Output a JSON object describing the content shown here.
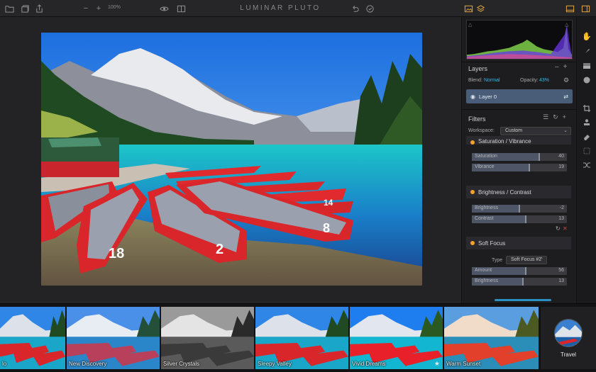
{
  "toolbar": {
    "zoom": "100%",
    "app_title": "LUMINAR PLUTO"
  },
  "layers": {
    "title": "Layers",
    "blend_label": "Blend:",
    "blend_value": "Normal",
    "opacity_label": "Opacity:",
    "opacity_value": "43%",
    "layer_name": "Layer 0"
  },
  "filters": {
    "title": "Filters",
    "workspace_label": "Workspace:",
    "workspace_value": "Custom",
    "groups": [
      {
        "title": "Saturation / Vibrance",
        "sliders": [
          {
            "label": "Saturation",
            "value": "40",
            "level": 0.7
          },
          {
            "label": "Vibrance",
            "value": "19",
            "level": 0.6
          }
        ]
      },
      {
        "title": "Brightness / Contrast",
        "sliders": [
          {
            "label": "Brightness",
            "value": "-2",
            "level": 0.49
          },
          {
            "label": "Contrast",
            "value": "13",
            "level": 0.56
          }
        ]
      },
      {
        "title": "Soft Focus",
        "type_label": "Type",
        "type_value": "Soft Focus #2",
        "sliders": [
          {
            "label": "Amount",
            "value": "56",
            "level": 0.56
          },
          {
            "label": "Brightness",
            "value": "13",
            "level": 0.53
          }
        ]
      }
    ]
  },
  "filmstrip": {
    "items": [
      {
        "label": "lo",
        "variant": "color"
      },
      {
        "label": "New Discovery",
        "variant": "cool"
      },
      {
        "label": "Silver Crystals",
        "variant": "bw"
      },
      {
        "label": "Sleepy Valley",
        "variant": "color"
      },
      {
        "label": "Vivid Dreams",
        "variant": "vivid",
        "starred": true
      },
      {
        "label": "Warm Sunset",
        "variant": "warm"
      }
    ],
    "category_label": "Travel"
  },
  "colors": {
    "accent": "#3fb5ea",
    "filter_dot": "#f2a12e",
    "layer_selected": "#4a5d78"
  }
}
